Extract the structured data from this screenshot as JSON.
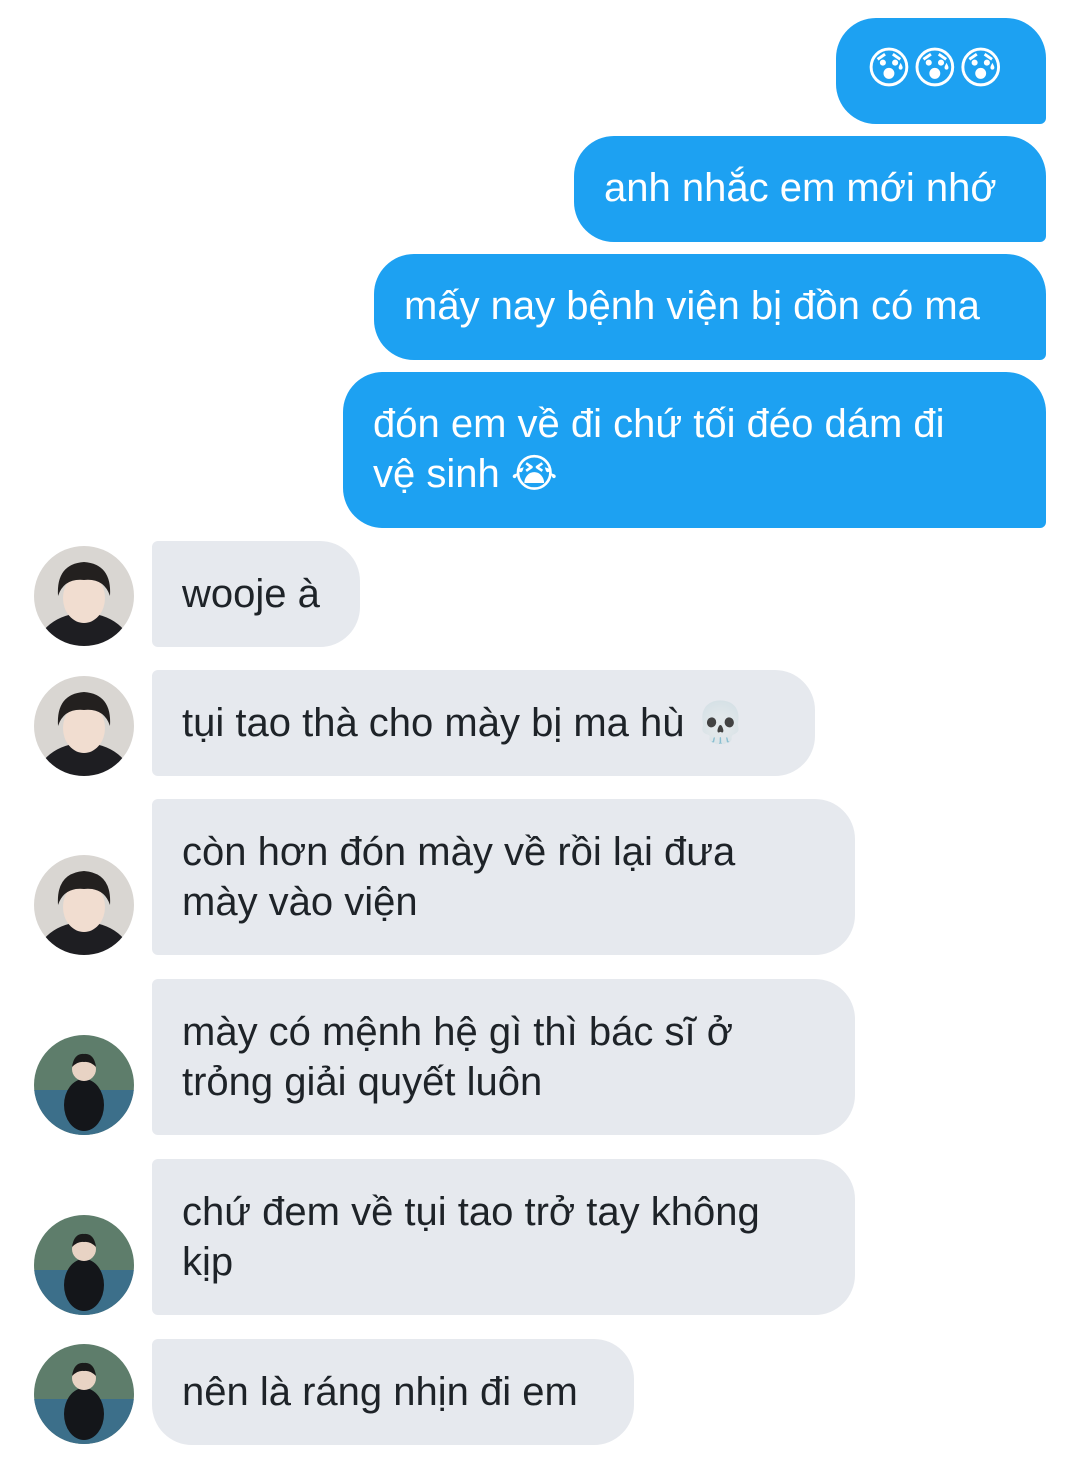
{
  "outgoing": [
    {
      "text": "😰😰😰"
    },
    {
      "text": "anh nhắc em mới nhớ"
    },
    {
      "text": "mấy nay bệnh viện bị đồn có ma"
    },
    {
      "text": "đón em về đi chứ tối đéo dám đi\nvệ sinh 😭"
    }
  ],
  "incoming": [
    {
      "text": "wooje à",
      "avatar": "avatar-dark-hair"
    },
    {
      "text": "tụi tao thà cho mày bị ma hù 💀",
      "avatar": "avatar-dark-hair"
    },
    {
      "text": "còn hơn đón mày về rồi lại đưa\nmày vào viện",
      "avatar": "avatar-dark-hair"
    },
    {
      "text": "mày có mệnh hệ gì thì bác sĩ ở\ntrỏng giải quyết luôn",
      "avatar": "avatar-court"
    },
    {
      "text": "chứ đem về tụi tao trở tay không\nkịp",
      "avatar": "avatar-court"
    },
    {
      "text": "nên là ráng nhịn đi em",
      "avatar": "avatar-court"
    }
  ],
  "colors": {
    "outgoing_bubble": "#1da1f2",
    "incoming_bubble": "#e6e9ee",
    "incoming_text": "#1e2328"
  }
}
